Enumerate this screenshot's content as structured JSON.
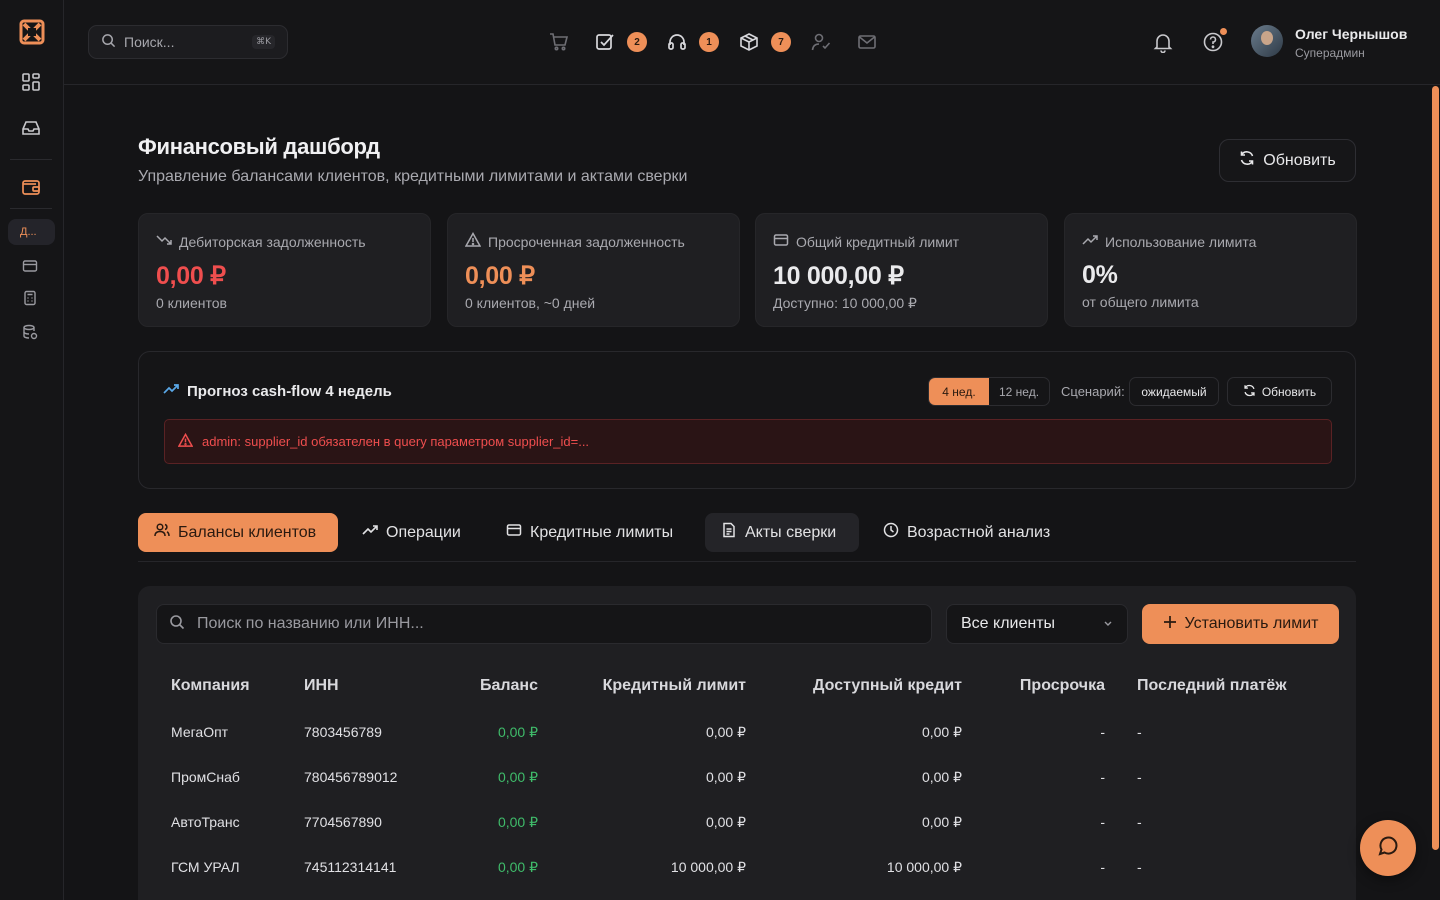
{
  "colors": {
    "accent": "#ee8f58",
    "danger": "#ef4e4e",
    "success": "#3fbb6a",
    "background": "#141416",
    "card": "#1f1f22"
  },
  "sidebar": {
    "active_item_label": "Д...",
    "icons": [
      "logo-icon",
      "dashboard-grid-icon",
      "inbox-icon",
      "wallet-icon",
      "credit-card-icon",
      "calculator-icon",
      "database-icon"
    ]
  },
  "topbar": {
    "search_placeholder": "Поиск...",
    "search_shortcut": "⌘K",
    "badges": {
      "tasks": "2",
      "support": "1",
      "packages": "7"
    },
    "user": {
      "name": "Олег Чернышов",
      "role": "Суперадмин"
    }
  },
  "header": {
    "title": "Финансовый дашборд",
    "subtitle": "Управление балансами клиентов, кредитными лимитами и актами сверки",
    "refresh_label": "Обновить"
  },
  "kpis": [
    {
      "label": "Дебиторская задолженность",
      "value": "0,00 ₽",
      "sub": "0 клиентов",
      "color": "#ef4e4e",
      "icon": "trending-down-icon"
    },
    {
      "label": "Просроченная задолженность",
      "value": "0,00 ₽",
      "sub": "0 клиентов, ~0 дней",
      "color": "#ee8f58",
      "icon": "warning-icon"
    },
    {
      "label": "Общий кредитный лимит",
      "value": "10 000,00 ₽",
      "sub": "Доступно: 10 000,00 ₽",
      "color": "#eaeaec",
      "icon": "credit-card-icon"
    },
    {
      "label": "Использование лимита",
      "value": "0%",
      "sub": "от общего лимита",
      "color": "#eaeaec",
      "icon": "trending-up-icon"
    }
  ],
  "cashflow": {
    "title": "Прогноз cash-flow 4 недель",
    "period_options": [
      "4 нед.",
      "12 нед."
    ],
    "selected_period": "4 нед.",
    "scenario_label": "Сценарий:",
    "scenario_value": "ожидаемый",
    "refresh_label": "Обновить",
    "error": "admin: supplier_id обязателен в query параметром supplier_id=..."
  },
  "tabs": [
    {
      "label": "Балансы клиентов",
      "icon": "users-icon",
      "active": true
    },
    {
      "label": "Операции",
      "icon": "trending-up-icon",
      "active": false
    },
    {
      "label": "Кредитные лимиты",
      "icon": "credit-card-icon",
      "active": false
    },
    {
      "label": "Акты сверки",
      "icon": "document-icon",
      "active": false
    },
    {
      "label": "Возрастной анализ",
      "icon": "clock-icon",
      "active": false
    }
  ],
  "table": {
    "search_placeholder": "Поиск по названию или ИНН...",
    "filter_value": "Все клиенты",
    "add_label": "Установить лимит",
    "columns": [
      "Компания",
      "ИНН",
      "Баланс",
      "Кредитный лимит",
      "Доступный кредит",
      "Просрочка",
      "Последний платёж"
    ],
    "rows": [
      [
        "МегаОпт",
        "7803456789",
        "0,00 ₽",
        "0,00 ₽",
        "0,00 ₽",
        "-",
        "-"
      ],
      [
        "ПромСнаб",
        "780456789012",
        "0,00 ₽",
        "0,00 ₽",
        "0,00 ₽",
        "-",
        "-"
      ],
      [
        "АвтоТранс",
        "7704567890",
        "0,00 ₽",
        "0,00 ₽",
        "0,00 ₽",
        "-",
        "-"
      ],
      [
        "ГСМ УРАЛ",
        "745112314141",
        "0,00 ₽",
        "10 000,00 ₽",
        "10 000,00 ₽",
        "-",
        "-"
      ]
    ]
  }
}
